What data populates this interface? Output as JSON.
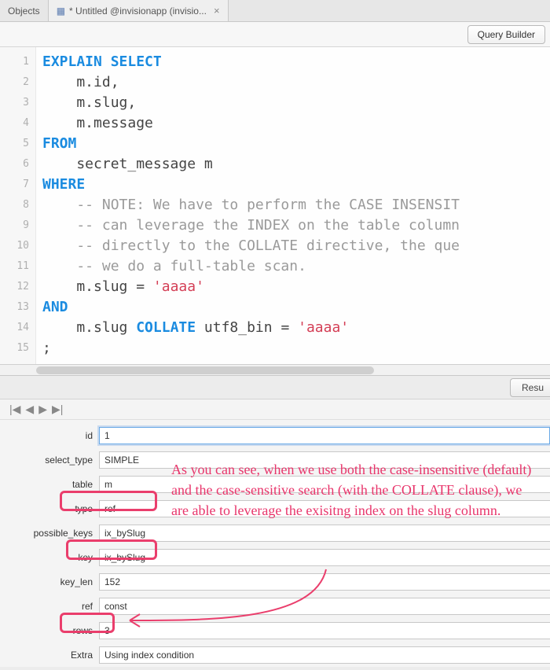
{
  "tabs": {
    "objects": "Objects",
    "active": "* Untitled @invisionapp (invisio..."
  },
  "toolbar": {
    "query_builder": "Query Builder",
    "results_btn": "Resu"
  },
  "code": {
    "lines": [
      {
        "t": "kw",
        "v": "EXPLAIN SELECT"
      },
      {
        "t": "plain",
        "v": "    m.id,"
      },
      {
        "t": "plain",
        "v": "    m.slug,"
      },
      {
        "t": "plain",
        "v": "    m.message"
      },
      {
        "t": "kw",
        "v": "FROM"
      },
      {
        "t": "plain",
        "v": "    secret_message m"
      },
      {
        "t": "kw",
        "v": "WHERE"
      },
      {
        "t": "cmt",
        "v": "    -- NOTE: We have to perform the CASE INSENSIT"
      },
      {
        "t": "cmt",
        "v": "    -- can leverage the INDEX on the table column"
      },
      {
        "t": "cmt",
        "v": "    -- directly to the COLLATE directive, the que"
      },
      {
        "t": "cmt",
        "v": "    -- we do a full-table scan."
      },
      {
        "t": "mix1",
        "v": ""
      },
      {
        "t": "kw",
        "v": "AND"
      },
      {
        "t": "mix2",
        "v": ""
      },
      {
        "t": "plain",
        "v": ";"
      }
    ],
    "mix1_a": "    m.slug = ",
    "mix1_b": "'aaaa'",
    "mix2_a": "    m.slug ",
    "mix2_b": "COLLATE",
    "mix2_c": " utf8_bin = ",
    "mix2_d": "'aaaa'"
  },
  "nav_icons": {
    "first": "|◀",
    "prev": "◀",
    "next": "▶",
    "last": "▶|"
  },
  "results": {
    "id_label": "id",
    "id_value": "1",
    "select_type_label": "select_type",
    "select_type_value": "SIMPLE",
    "table_label": "table",
    "table_value": "m",
    "type_label": "type",
    "type_value": "ref",
    "possible_keys_label": "possible_keys",
    "possible_keys_value": "ix_bySlug",
    "key_label": "key",
    "key_value": "ix_bySlug",
    "key_len_label": "key_len",
    "key_len_value": "152",
    "ref_label": "ref",
    "ref_value": "const",
    "rows_label": "rows",
    "rows_value": "3",
    "extra_label": "Extra",
    "extra_value": "Using index condition"
  },
  "annotation": "As you can see, when we use both the case-insensitive (default) and the case-sensitive search (with the COLLATE clause), we are able to leverage the exisitng index on the slug column."
}
